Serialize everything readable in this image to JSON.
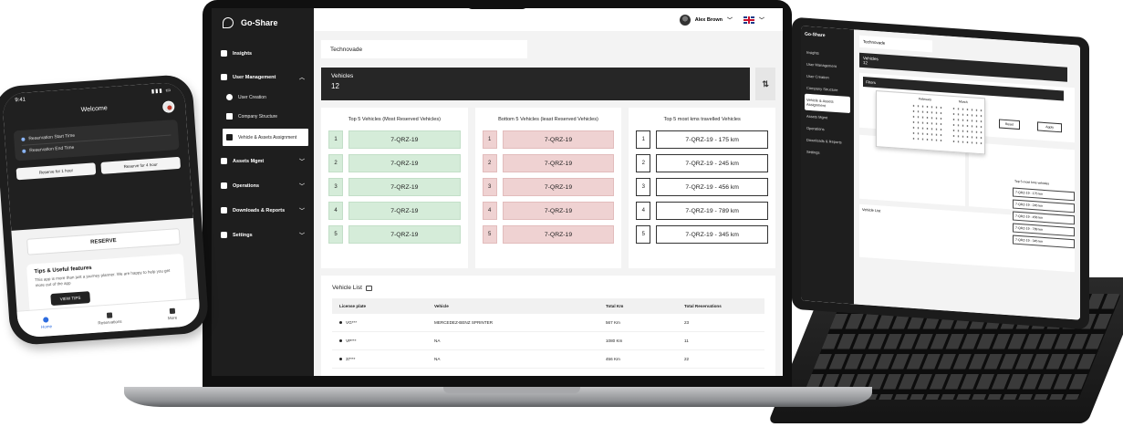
{
  "app": {
    "name": "Go-Share"
  },
  "header": {
    "user_name": "Alex Brown"
  },
  "sidebar": {
    "items": [
      {
        "label": "Insights"
      },
      {
        "label": "User Management"
      },
      {
        "label": "Assets Mgmt"
      },
      {
        "label": "Operations"
      },
      {
        "label": "Downloads & Reports"
      },
      {
        "label": "Settings"
      }
    ],
    "sub_items": [
      {
        "label": "User Creation"
      },
      {
        "label": "Company Structure"
      },
      {
        "label": "Vehicle & Assets Assignment"
      }
    ]
  },
  "main": {
    "organization": "Technovade",
    "vehicles_label": "Vehicles",
    "vehicles_count": "12",
    "top5": {
      "title": "Top 5 Vehicles (Most Reserved Vehicles)",
      "items": [
        {
          "rank": "1",
          "value": "7-QRZ-19"
        },
        {
          "rank": "2",
          "value": "7-QRZ-19"
        },
        {
          "rank": "3",
          "value": "7-QRZ-19"
        },
        {
          "rank": "4",
          "value": "7-QRZ-19"
        },
        {
          "rank": "5",
          "value": "7-QRZ-19"
        }
      ]
    },
    "bottom5": {
      "title": "Bottom 5 Vehicles (least Reserved Vehicles)",
      "items": [
        {
          "rank": "1",
          "value": "7-QRZ-19"
        },
        {
          "rank": "2",
          "value": "7-QRZ-19"
        },
        {
          "rank": "3",
          "value": "7-QRZ-19"
        },
        {
          "rank": "4",
          "value": "7-QRZ-19"
        },
        {
          "rank": "5",
          "value": "7-QRZ-19"
        }
      ]
    },
    "km5": {
      "title": "Top 5 most kms travelled Vehicles",
      "items": [
        {
          "rank": "1",
          "value": "7-QRZ-19 - 175 km"
        },
        {
          "rank": "2",
          "value": "7-QRZ-19 - 245 km"
        },
        {
          "rank": "3",
          "value": "7-QRZ-19 - 456 km"
        },
        {
          "rank": "4",
          "value": "7-QRZ-19 - 789 km"
        },
        {
          "rank": "5",
          "value": "7-QRZ-19 - 345 km"
        }
      ]
    },
    "vehicle_list": {
      "title": "Vehicle List",
      "columns": [
        "License plate",
        "Vehicle",
        "Total Km",
        "Total Reservations"
      ],
      "rows": [
        {
          "plate": "VG***",
          "vehicle": "MERCEDEZ-BENZ SPRINTER",
          "km": "567 Km",
          "reservations": "23"
        },
        {
          "plate": "VP***",
          "vehicle": "NA",
          "km": "1080 Km",
          "reservations": "11"
        },
        {
          "plate": "37***",
          "vehicle": "NA",
          "km": "456 Km",
          "reservations": "22"
        }
      ]
    }
  },
  "phone": {
    "time": "9:41",
    "title": "Welcome",
    "start_label": "Reservation Start Time",
    "end_label": "Reservation End Time",
    "slot1": "Reserve for 1 hour",
    "slot2": "Reserve for 4 hour",
    "reserve_btn": "RESERVE",
    "tips_title": "Tips & Useful features",
    "tips_text": "This app is more than just a journey planner. We are happy to help you get more out of the app",
    "view_tips": "VIEW TIPS",
    "nav": [
      "Home",
      "Reservations",
      "More"
    ]
  },
  "tablet": {
    "brand": "Go-Share",
    "organization": "Technovade",
    "vehicles_label": "Vehicles",
    "vehicles_count": "12",
    "filters": "Filters",
    "month1": "February",
    "month2": "March",
    "reset": "Reset",
    "apply": "Apply",
    "km_title": "Top 5 most kms vehicles",
    "km": [
      "7-QRZ-19 - 175 km",
      "7-QRZ-19 - 245 km",
      "7-QRZ-19 - 456 km",
      "7-QRZ-19 - 789 km",
      "7-QRZ-19 - 345 km"
    ],
    "vehicle_list": "Vehicle List"
  },
  "colors": {
    "dark": "#1e1e1e",
    "green": "#d5ecd9",
    "red": "#efd2d2"
  }
}
